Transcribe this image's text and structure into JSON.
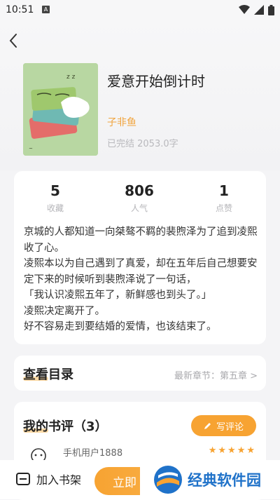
{
  "status_bar": {
    "time": "10:51",
    "badge": "A"
  },
  "book": {
    "title": "爱意开始倒计时",
    "author": "子非鱼",
    "meta": "已完结 2053.0字"
  },
  "stats": [
    {
      "value": "5",
      "label": "收藏"
    },
    {
      "value": "806",
      "label": "人气"
    },
    {
      "value": "1",
      "label": "点赞"
    }
  ],
  "description": [
    "京城的人都知道一向桀骜不羁的裴煦泽为了追到凌熙收了心。",
    "凌熙本以为自己遇到了真爱，却在五年后自己想要安定下来的时候听到裴煦泽说了一句话，",
    "「我认识凌熙五年了，新鲜感也到头了。」",
    "凌熙决定离开了。",
    "好不容易走到要结婚的爱情，也该结束了。"
  ],
  "toc": {
    "title": "查看目录",
    "latest": "最新章节：第五章 >"
  },
  "reviews": {
    "title": "我的书评（3）",
    "write_label": "写评论",
    "first_user": "手机用户1888",
    "first_rating": 5
  },
  "bottom": {
    "add_shelf": "加入书架",
    "read_now": "立即"
  },
  "watermark": {
    "text": "经典软件园"
  },
  "colors": {
    "accent": "#f7a332",
    "author": "#f1a33b",
    "watermark": "#1f72c9"
  }
}
